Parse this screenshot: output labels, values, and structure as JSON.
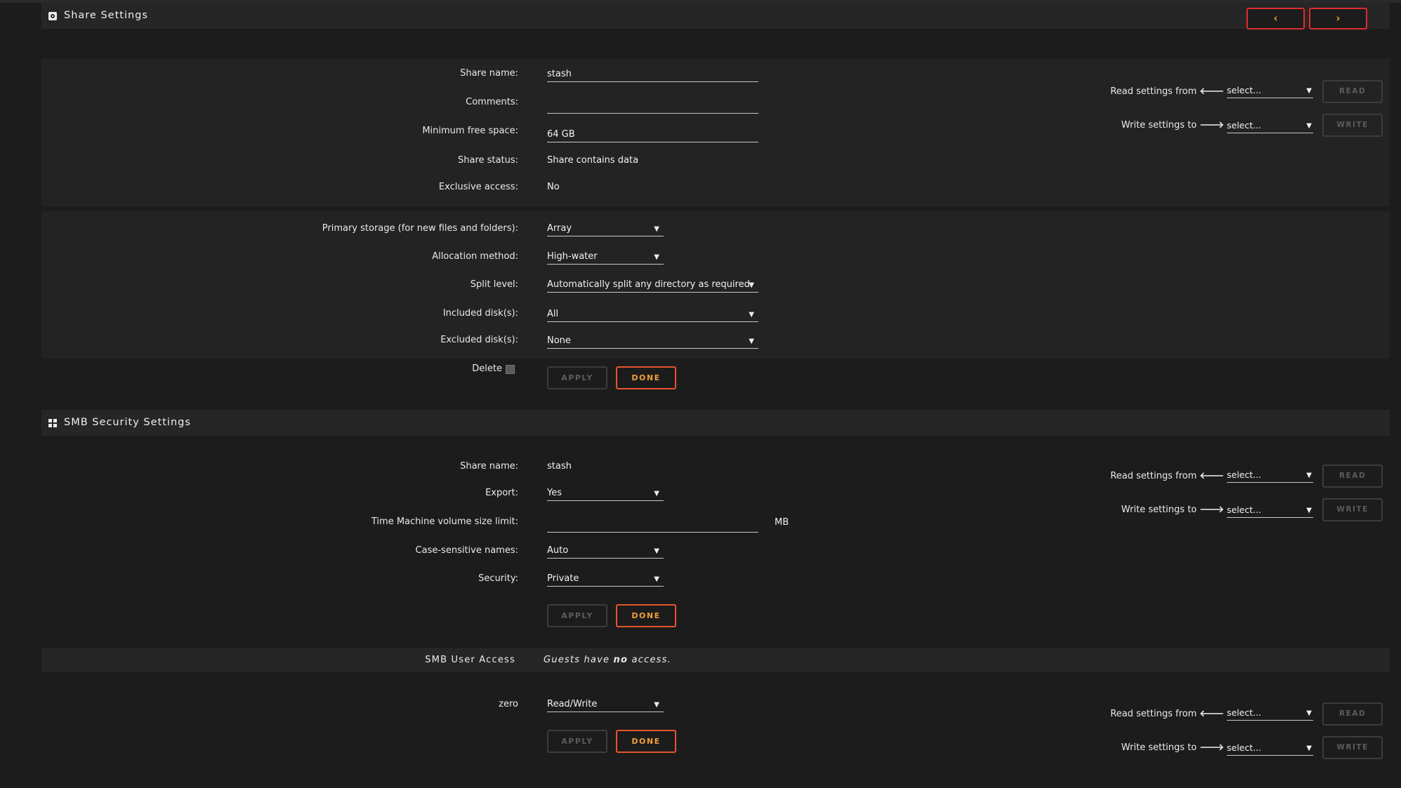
{
  "share_settings": {
    "title": "Share Settings",
    "nav": {
      "prev": "‹",
      "next": "›"
    },
    "fields": {
      "share_name": {
        "label": "Share name:",
        "value": "stash"
      },
      "comments": {
        "label": "Comments:",
        "value": ""
      },
      "min_free": {
        "label": "Minimum free space:",
        "value": "64 GB"
      },
      "status": {
        "label": "Share status:",
        "value": "Share contains data"
      },
      "exclusive": {
        "label": "Exclusive access:",
        "value": "No"
      },
      "primary_storage": {
        "label": "Primary storage (for new files and folders):",
        "value": "Array"
      },
      "allocation": {
        "label": "Allocation method:",
        "value": "High-water"
      },
      "split_level": {
        "label": "Split level:",
        "value": "Automatically split any directory as required"
      },
      "included": {
        "label": "Included disk(s):",
        "value": "All"
      },
      "excluded": {
        "label": "Excluded disk(s):",
        "value": "None"
      },
      "delete": {
        "label": "Delete",
        "checked": false
      }
    },
    "buttons": {
      "apply": "APPLY",
      "done": "DONE"
    },
    "read_write": {
      "read_label": "Read settings from",
      "write_label": "Write settings to",
      "read_select": "select...",
      "write_select": "select...",
      "read_btn": "READ",
      "write_btn": "WRITE"
    }
  },
  "smb_security": {
    "title": "SMB Security Settings",
    "fields": {
      "share_name": {
        "label": "Share name:",
        "value": "stash"
      },
      "export": {
        "label": "Export:",
        "value": "Yes"
      },
      "tm_limit": {
        "label": "Time Machine volume size limit:",
        "value": "",
        "unit": "MB"
      },
      "case_sensitive": {
        "label": "Case-sensitive names:",
        "value": "Auto"
      },
      "security": {
        "label": "Security:",
        "value": "Private"
      }
    },
    "buttons": {
      "apply": "APPLY",
      "done": "DONE"
    },
    "read_write": {
      "read_label": "Read settings from",
      "write_label": "Write settings to",
      "read_select": "select...",
      "write_select": "select...",
      "read_btn": "READ",
      "write_btn": "WRITE"
    }
  },
  "smb_user_access": {
    "title": "SMB User Access",
    "guests_prefix": "Guests have ",
    "guests_emph": "no",
    "guests_suffix": " access.",
    "user": {
      "label": "zero",
      "value": "Read/Write"
    },
    "buttons": {
      "apply": "APPLY",
      "done": "DONE"
    },
    "read_write": {
      "read_label": "Read settings from",
      "write_label": "Write settings to",
      "read_select": "select...",
      "write_select": "select...",
      "read_btn": "READ",
      "write_btn": "WRITE"
    }
  },
  "icons": {
    "share": "share-icon",
    "windows": "windows-icon",
    "arrow_left": "arrow-left-icon",
    "arrow_right": "arrow-right-icon",
    "caret": "caret-down-icon"
  },
  "colors": {
    "accent_red": "#e02c2c",
    "accent_orange": "#f2a03c",
    "done_border": "#e8542e",
    "background": "#1c1c1c",
    "panel": "#232323"
  }
}
